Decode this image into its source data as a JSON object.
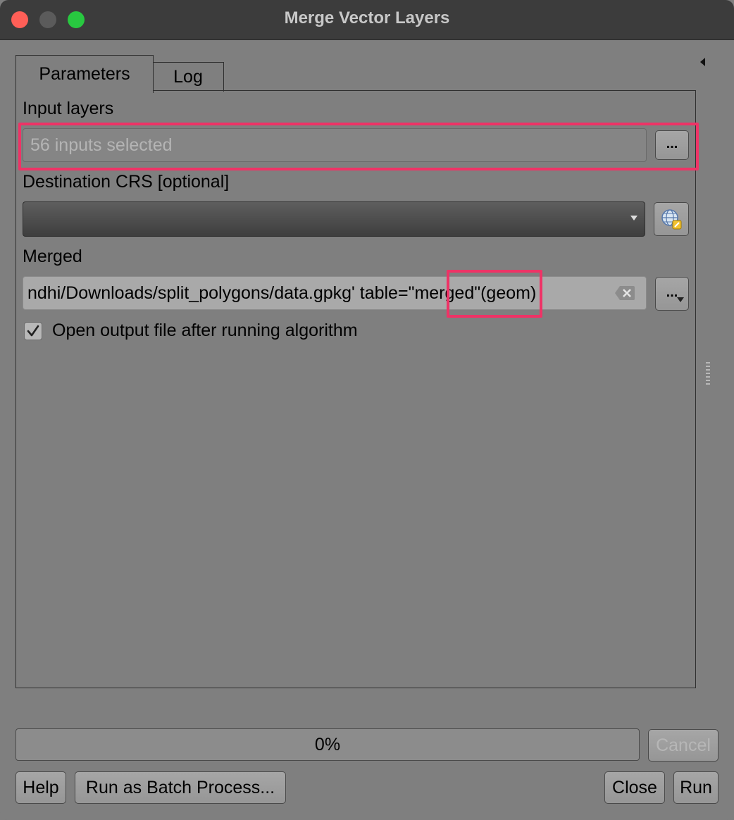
{
  "window": {
    "title": "Merge Vector Layers"
  },
  "tabs": [
    {
      "label": "Parameters",
      "active": true
    },
    {
      "label": "Log",
      "active": false
    }
  ],
  "params": {
    "input_layers": {
      "label": "Input layers",
      "placeholder": "56 inputs selected",
      "browse_label": "..."
    },
    "destination_crs": {
      "label": "Destination CRS [optional]",
      "value": ""
    },
    "merged": {
      "label": "Merged",
      "value_pre": "ndhi/Downloads/split_polygons/data.gpkg' table=",
      "value_highlight": "\"merged\"",
      "value_post": " (geom)",
      "browse_label": "..."
    },
    "open_output": {
      "label": "Open output file after running algorithm",
      "checked": true
    }
  },
  "progress": {
    "text": "0%",
    "value": 0
  },
  "buttons": {
    "cancel": "Cancel",
    "help": "Help",
    "batch": "Run as Batch Process...",
    "close": "Close",
    "run": "Run"
  },
  "colors": {
    "highlight": "#ee3366",
    "background": "#7f7f7f",
    "titlebar": "#3c3c3c"
  }
}
